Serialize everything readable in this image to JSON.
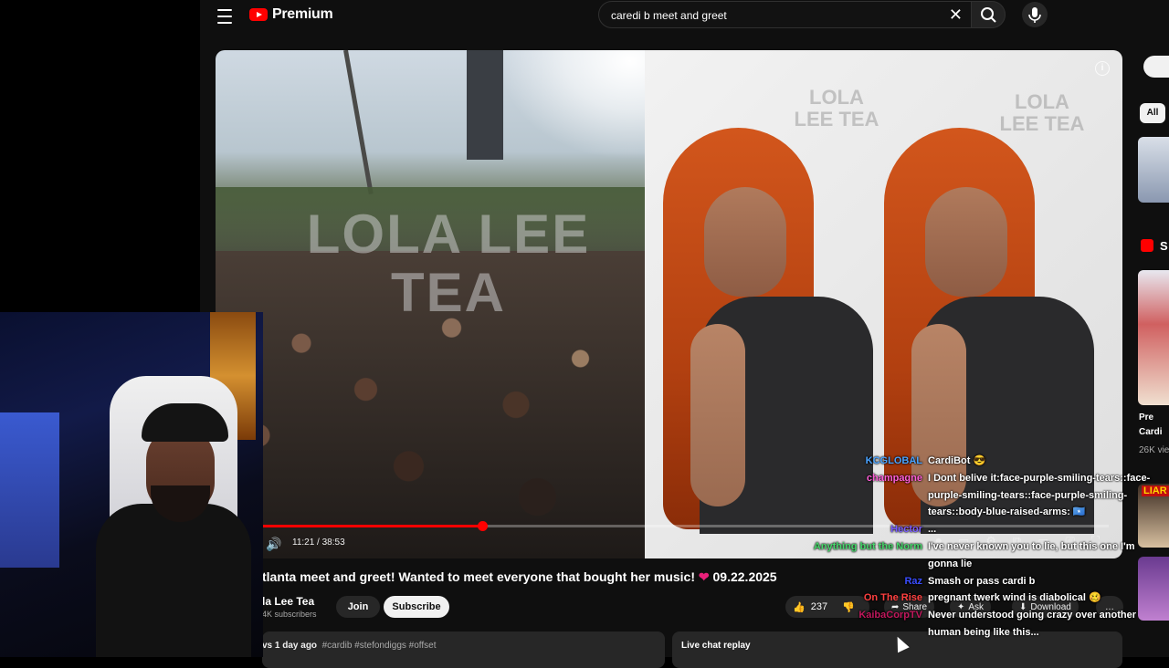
{
  "header": {
    "logo_text": "Premium",
    "search_value": "caredi b meet and greet"
  },
  "video": {
    "watermark": "LOLA LEE TEA",
    "watermark_small": "LOLA LEE TEA",
    "progress": 0.2623,
    "time": "11:21 / 38:53"
  },
  "meta": {
    "title": "tlanta meet and greet! Wanted to meet everyone that bought her music!",
    "title_heart": "❤",
    "title_date": "09.22.2025",
    "channel_name": "la Lee Tea",
    "subscribers": "4K subscribers",
    "join_label": "Join",
    "subscribe_label": "Subscribe",
    "likes": "237",
    "share_label": "Share",
    "ask_label": "Ask",
    "download_label": "Download",
    "more_label": "…"
  },
  "description": {
    "views_time": "vs  1 day ago",
    "tags": "#cardib #stefondiggs #offset"
  },
  "livechat": {
    "label": "Live chat replay"
  },
  "sidebar": {
    "chip_all": "All",
    "item1_title": "Pre",
    "item1_channel": "Cardi",
    "item1_views": "26K vie",
    "item_small_s": "S",
    "badge_text": "LIAR"
  },
  "chat": [
    {
      "name": "KCGLOBAL",
      "name_color": "#4aa3ff",
      "msg": "CardiBot 😎"
    },
    {
      "name": "champagne",
      "name_color": "#ff5fd7",
      "msg": "I Dont belive it:face-purple-smiling-tears::face-"
    },
    {
      "name": "",
      "name_color": "#ffffff",
      "msg": "purple-smiling-tears::face-purple-smiling-"
    },
    {
      "name": "",
      "name_color": "#ffffff",
      "msg": "tears::body-blue-raised-arms: 🇸🇴"
    },
    {
      "name": "Hector",
      "name_color": "#7b5cff",
      "msg": "..."
    },
    {
      "name": "Anything but the Norm",
      "name_color": "#46d66b",
      "msg": "I've never known you to lie, but this one I'm"
    },
    {
      "name": "",
      "name_color": "#ffffff",
      "msg": "gonna lie"
    },
    {
      "name": "Raz",
      "name_color": "#3a4dff",
      "msg": "Smash or pass cardi b"
    },
    {
      "name": "On The Rise",
      "name_color": "#ff4040",
      "msg": "pregnant twerk wind is diabolical 🥴"
    },
    {
      "name": "KaibaCorpTV",
      "name_color": "#c0185c",
      "msg": "Never understood going crazy over another"
    },
    {
      "name": "",
      "name_color": "#ffffff",
      "msg": "human being like this..."
    }
  ]
}
